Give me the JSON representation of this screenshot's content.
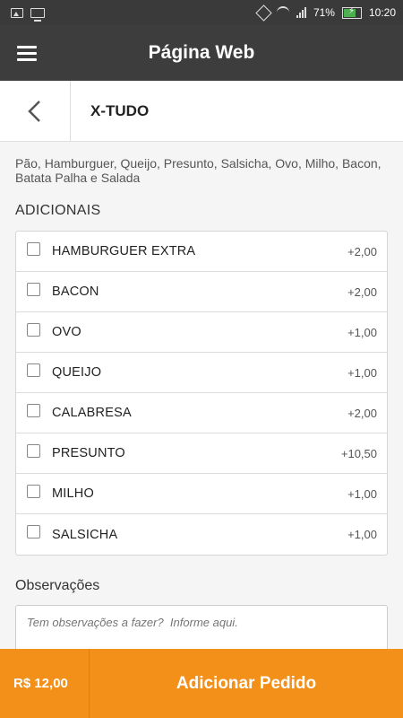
{
  "statusbar": {
    "battery": "71%",
    "time": "10:20"
  },
  "appbar": {
    "title": "Página Web"
  },
  "item": {
    "title": "X-TUDO",
    "description": "Pão, Hamburguer, Queijo, Presunto, Salsicha, Ovo, Milho, Bacon, Batata Palha e Salada"
  },
  "adicionais": {
    "title": "ADICIONAIS",
    "items": [
      {
        "label": "HAMBURGUER EXTRA",
        "price": "+2,00"
      },
      {
        "label": "BACON",
        "price": "+2,00"
      },
      {
        "label": "OVO",
        "price": "+1,00"
      },
      {
        "label": "QUEIJO",
        "price": "+1,00"
      },
      {
        "label": "CALABRESA",
        "price": "+2,00"
      },
      {
        "label": "PRESUNTO",
        "price": "+10,50"
      },
      {
        "label": "MILHO",
        "price": "+1,00"
      },
      {
        "label": "SALSICHA",
        "price": "+1,00"
      }
    ]
  },
  "observacoes": {
    "title": "Observações",
    "placeholder": "Tem observações a fazer?  Informe aqui."
  },
  "footer": {
    "price": "R$ 12,00",
    "button": "Adicionar Pedido"
  },
  "colors": {
    "accent": "#f39019",
    "appbar": "#3d3d3d"
  }
}
